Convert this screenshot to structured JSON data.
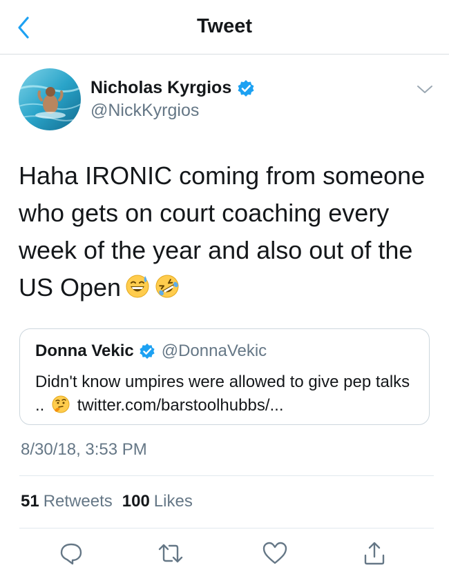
{
  "header": {
    "title": "Tweet"
  },
  "tweet": {
    "author": {
      "name": "Nicholas Kyrgios",
      "handle": "@NickKyrgios"
    },
    "text": "Haha IRONIC coming from someone who gets on court coaching every week of the year and also out of the US Open",
    "emojis": [
      "grinning-sweat-emoji",
      "rolling-laughing-emoji"
    ],
    "quoted": {
      "name": "Donna Vekic",
      "handle": "@DonnaVekic",
      "text_before": "Didn't know umpires were allowed to give pep talks ..",
      "emoji": "thinking-face-emoji",
      "link": "twitter.com/barstoolhubbs/..."
    },
    "timestamp": "8/30/18, 3:53 PM",
    "stats": {
      "retweets_count": "51",
      "retweets_label": "Retweets",
      "likes_count": "100",
      "likes_label": "Likes"
    }
  },
  "actions": [
    {
      "icon": "reply-icon"
    },
    {
      "icon": "retweet-icon"
    },
    {
      "icon": "like-icon"
    },
    {
      "icon": "share-icon"
    }
  ],
  "colors": {
    "accent": "#1da1f2",
    "secondary_text": "#657786",
    "border": "#e1e8ed"
  }
}
